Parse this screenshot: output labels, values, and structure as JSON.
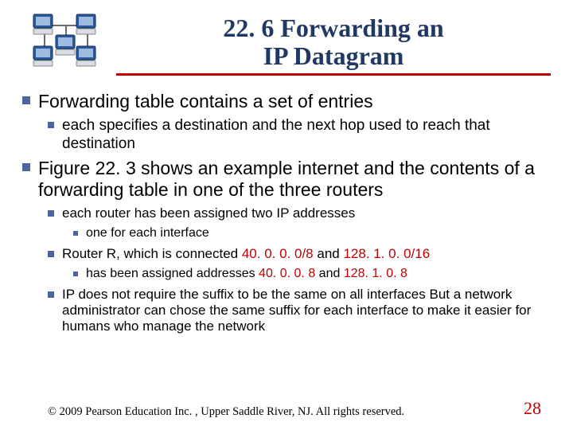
{
  "title": {
    "line1": "22. 6  Forwarding an",
    "line2": "IP Datagram"
  },
  "bullets": {
    "b1": "Forwarding table contains a set of entries",
    "b1_1": "each specifies a destination and the next hop used to reach that destination",
    "b2": "Figure 22. 3 shows an example internet and the contents of a forwarding table in one of the three routers",
    "b2_1": "each router has been assigned two IP addresses",
    "b2_1_1": "one for each interface",
    "b2_2_pre": "Router R, which is connected ",
    "b2_2_mid": " and ",
    "b2_2_r1": "40. 0. 0. 0/8",
    "b2_2_r2": "128. 1. 0. 0/16",
    "b2_2_1_pre": "has been assigned addresses ",
    "b2_2_1_mid": " and ",
    "b2_2_1_r1": "40. 0. 0. 8",
    "b2_2_1_r2": "128. 1. 0. 8",
    "b2_3": "IP does not require the suffix to be the same on all interfaces But a network administrator can chose the same suffix for each interface to make it easier for humans who manage the network"
  },
  "footer": {
    "copyright": "© 2009 Pearson Education Inc. , Upper Saddle River, NJ. All rights reserved.",
    "page": "28"
  },
  "colors": {
    "accent": "#c00000",
    "bullet": "#4a66a0",
    "title": "#1f3864"
  }
}
